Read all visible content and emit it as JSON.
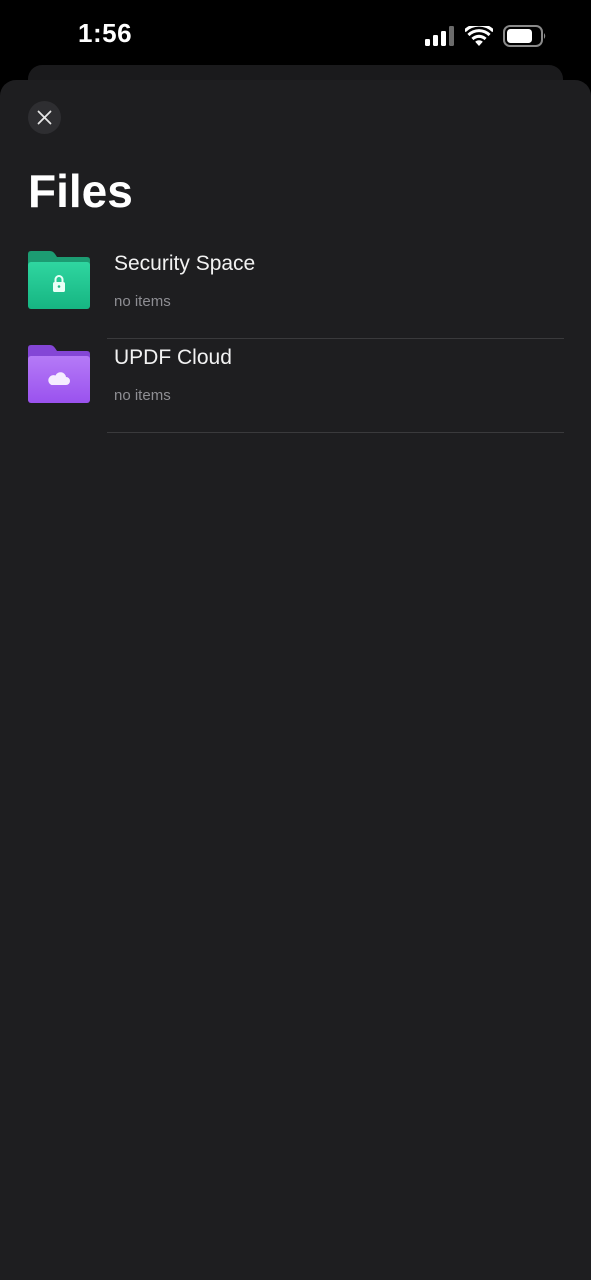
{
  "status_bar": {
    "time": "1:56",
    "icons": [
      "cellular-signal-icon",
      "wifi-icon",
      "battery-icon"
    ]
  },
  "header": {
    "close_icon": "close-icon",
    "title": "Files"
  },
  "items": [
    {
      "title": "Security Space",
      "subtitle": "no items",
      "icon": "lock-folder-icon",
      "color": "#22c08e"
    },
    {
      "title": "UPDF Cloud",
      "subtitle": "no items",
      "icon": "cloud-folder-icon",
      "color": "#a25df0"
    }
  ],
  "colors": {
    "sheet_background": "#1e1e20",
    "divider": "#3a3a3c",
    "secondary_text": "#8e8e93"
  }
}
